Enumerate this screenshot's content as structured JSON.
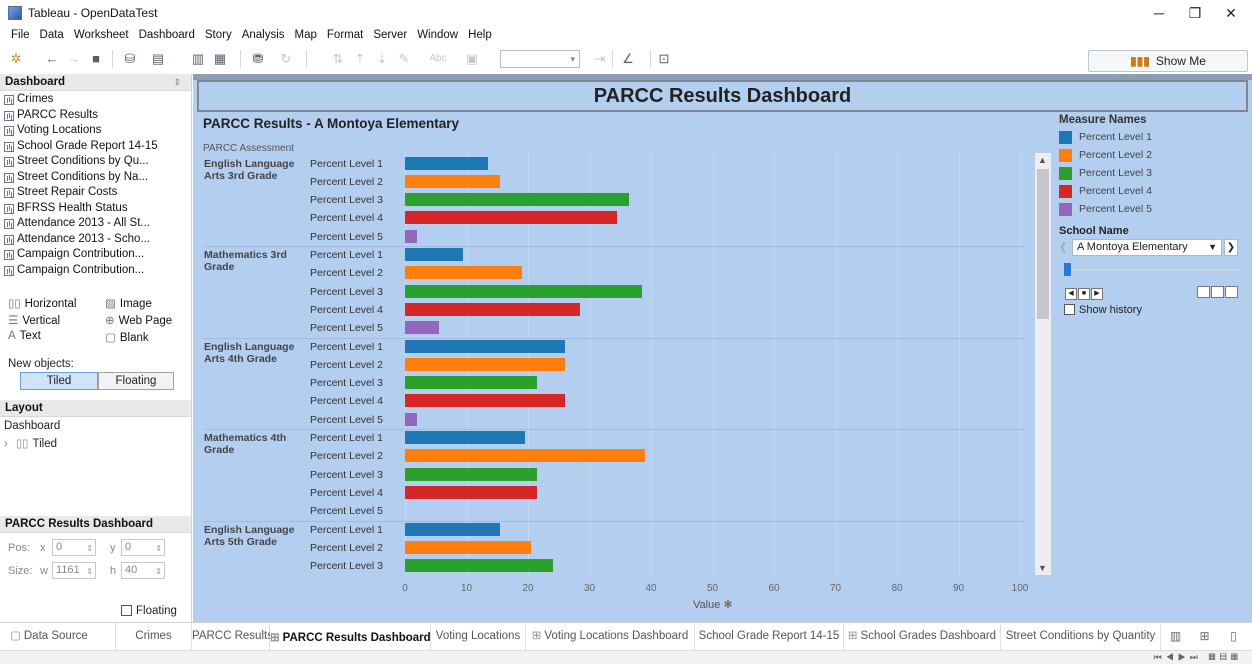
{
  "window": {
    "title": "Tableau - OpenDataTest"
  },
  "menu": [
    "File",
    "Data",
    "Worksheet",
    "Dashboard",
    "Story",
    "Analysis",
    "Map",
    "Format",
    "Server",
    "Window",
    "Help"
  ],
  "toolbar": {
    "show_me": "Show Me"
  },
  "dashboard_panel": {
    "header": "Dashboard",
    "sheets": [
      "Crimes",
      "PARCC Results",
      "Voting Locations",
      "School Grade Report 14-15",
      "Street Conditions by Qu...",
      "Street Conditions by Na...",
      "Street Repair Costs",
      "BFRSS Health Status",
      "Attendance 2013 - All St...",
      "Attendance 2013 - Scho...",
      "Campaign Contribution...",
      "Campaign Contribution..."
    ],
    "objects": {
      "horizontal": "Horizontal",
      "image": "Image",
      "vertical": "Vertical",
      "web_page": "Web Page",
      "text": "Text",
      "blank": "Blank"
    },
    "new_objects_label": "New objects:",
    "tiled": "Tiled",
    "floating": "Floating"
  },
  "layout_panel": {
    "header": "Layout",
    "root": "Dashboard",
    "child": "Tiled"
  },
  "selection_panel": {
    "header": "PARCC Results Dashboard",
    "pos_label": "Pos:",
    "size_label": "Size:",
    "x_label": "x",
    "x": "0",
    "y_label": "y",
    "y": "0",
    "w_label": "w",
    "w": "1161",
    "h_label": "h",
    "h": "40",
    "floating_label": "Floating"
  },
  "dashboard": {
    "title": "PARCC Results Dashboard",
    "sheet_title": "PARCC Results - A Montoya Elementary",
    "column_header": "PARCC Assessment"
  },
  "chart_data": {
    "type": "bar",
    "orientation": "horizontal",
    "xlabel": "Value",
    "xlim": [
      0,
      100
    ],
    "xticks": [
      0,
      10,
      20,
      30,
      40,
      50,
      60,
      70,
      80,
      90,
      100
    ],
    "grid": true,
    "groups": [
      {
        "name": "English Language Arts 3rd Grade",
        "values": [
          13.5,
          15.5,
          36.5,
          34.5,
          2
        ]
      },
      {
        "name": "Mathematics 3rd Grade",
        "values": [
          9.5,
          19,
          38.5,
          28.5,
          5.5
        ]
      },
      {
        "name": "English Language Arts 4th Grade",
        "values": [
          26,
          26,
          21.5,
          26,
          2
        ]
      },
      {
        "name": "Mathematics 4th Grade",
        "values": [
          19.5,
          39,
          21.5,
          21.5,
          null
        ]
      },
      {
        "name": "English Language Arts 5th Grade",
        "values": [
          15.5,
          20.5,
          24
        ]
      }
    ],
    "levels": [
      "Percent Level 1",
      "Percent Level 2",
      "Percent Level 3",
      "Percent Level 4",
      "Percent Level 5"
    ],
    "legend": {
      "title": "Measure Names",
      "position": "right",
      "items": [
        {
          "name": "Percent Level 1",
          "color": "#1f77b4"
        },
        {
          "name": "Percent Level 2",
          "color": "#ff7f0e"
        },
        {
          "name": "Percent Level 3",
          "color": "#2ca02c"
        },
        {
          "name": "Percent Level 4",
          "color": "#d62728"
        },
        {
          "name": "Percent Level 5",
          "color": "#9467bd"
        }
      ]
    }
  },
  "filter": {
    "title": "School Name",
    "selected": "A Montoya Elementary",
    "show_history": "Show history"
  },
  "tabs": {
    "data_source": "Data Source",
    "items": [
      "Crimes",
      "PARCC Results",
      "PARCC Results Dashboard",
      "Voting Locations",
      "Voting Locations Dashboard",
      "School Grade Report 14-15",
      "School Grades Dashboard",
      "Street Conditions by Quantity"
    ],
    "active_index": 2
  }
}
